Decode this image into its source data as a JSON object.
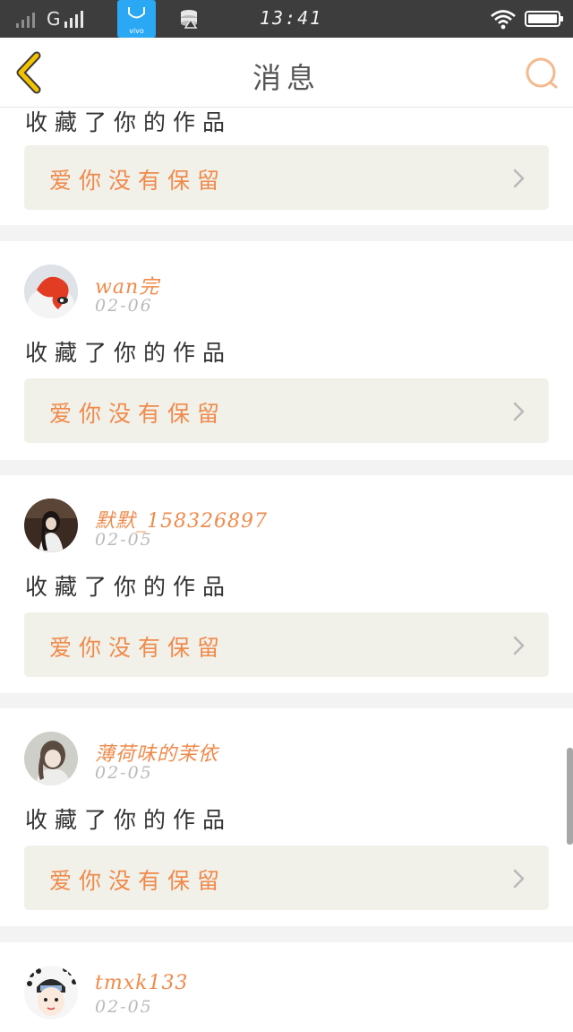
{
  "status_bar": {
    "network": "G",
    "store_label": "vivo",
    "time": "13:41"
  },
  "header": {
    "title": "消息"
  },
  "first_card_partial": {
    "action": "收藏了你的作品",
    "work_title": "爱你没有保留"
  },
  "messages": [
    {
      "username": "wan完",
      "date": "02-06",
      "action": "收藏了你的作品",
      "work_title": "爱你没有保留"
    },
    {
      "username": "默默_158326897",
      "date": "02-05",
      "action": "收藏了你的作品",
      "work_title": "爱你没有保留"
    },
    {
      "username": "薄荷味的茉依",
      "date": "02-05",
      "action": "收藏了你的作品",
      "work_title": "爱你没有保留"
    },
    {
      "username": "tmxk133",
      "date": "02-05"
    }
  ],
  "colors": {
    "accent": "#f08a4b",
    "back_arrow": "#f5c200",
    "status_bar": "#3d3d3d",
    "store_icon": "#2aa8f3"
  },
  "icons": {
    "back": "chevron-left-icon",
    "search": "search-icon",
    "chevron": "chevron-right-icon"
  }
}
